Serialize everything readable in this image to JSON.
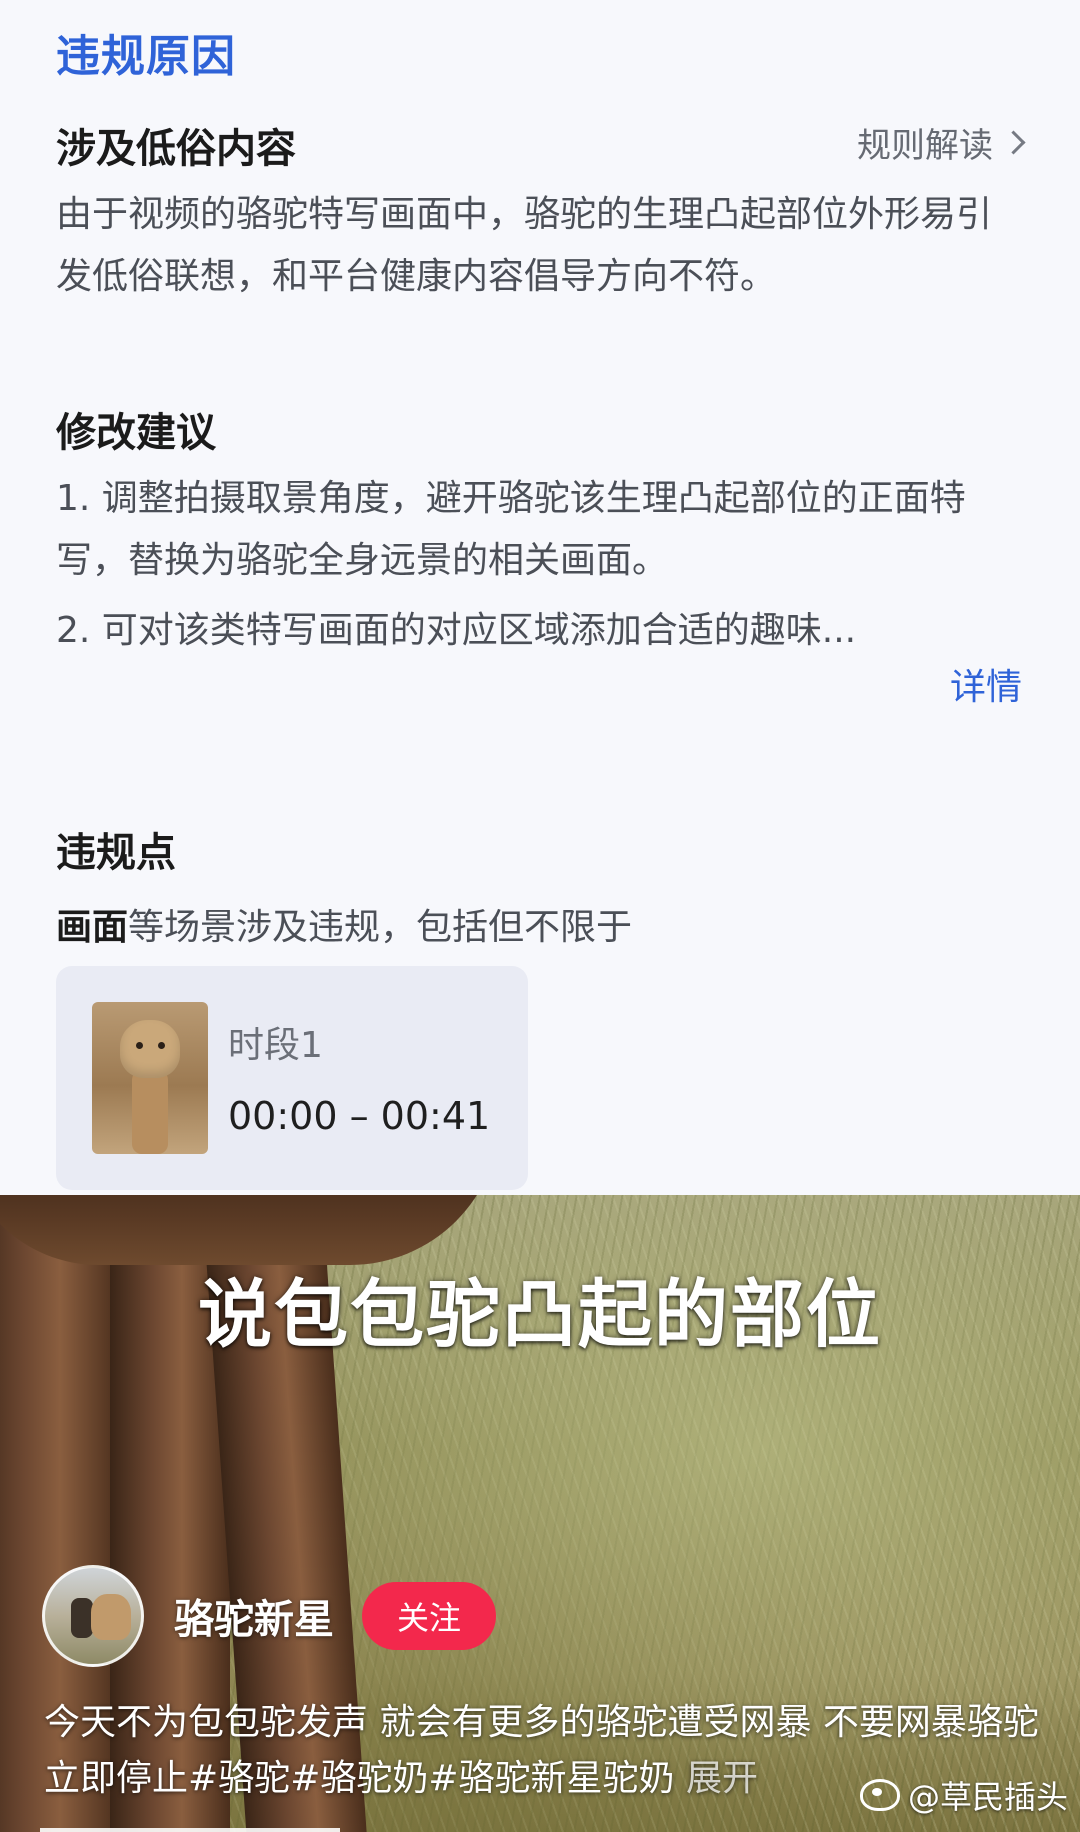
{
  "review": {
    "section_title": "违规原因",
    "reason": {
      "title": "涉及低俗内容",
      "rules_link": "规则解读",
      "text": "由于视频的骆驼特写画面中，骆驼的生理凸起部位外形易引发低俗联想，和平台健康内容倡导方向不符。"
    },
    "suggestions": {
      "title": "修改建议",
      "item1": "1. 调整拍摄取景角度，避开骆驼该生理凸起部位的正面特写，替换为骆驼全身远景的相关画面。",
      "item2": "2. 可对该类特写画面的对应区域添加合适的趣味...",
      "detail_link": "详情"
    },
    "violation_points": {
      "title": "违规点",
      "lead_bold": "画面",
      "lead_rest": "等场景涉及违规，包括但不限于",
      "segment": {
        "name": "时段1",
        "range": "00:00 – 00:41"
      }
    }
  },
  "video": {
    "caption": "说包包驼凸起的部位",
    "author": {
      "name": "骆驼新星",
      "follow_label": "关注"
    },
    "description_text": "今天不为包包驼发声 就会有更多的骆驼遭受网暴  不要网暴骆驼 立即停止",
    "hashtags": [
      "#骆驼",
      "#骆驼奶",
      "#骆驼新星驼奶"
    ],
    "expand_label": "展开",
    "watermark": "@草民插头"
  },
  "colors": {
    "accent_blue": "#2f63d8",
    "follow_red": "#f3284c"
  },
  "icons": {
    "rules_chevron": "chevron-right-icon",
    "watermark_logo": "weibo-icon"
  }
}
